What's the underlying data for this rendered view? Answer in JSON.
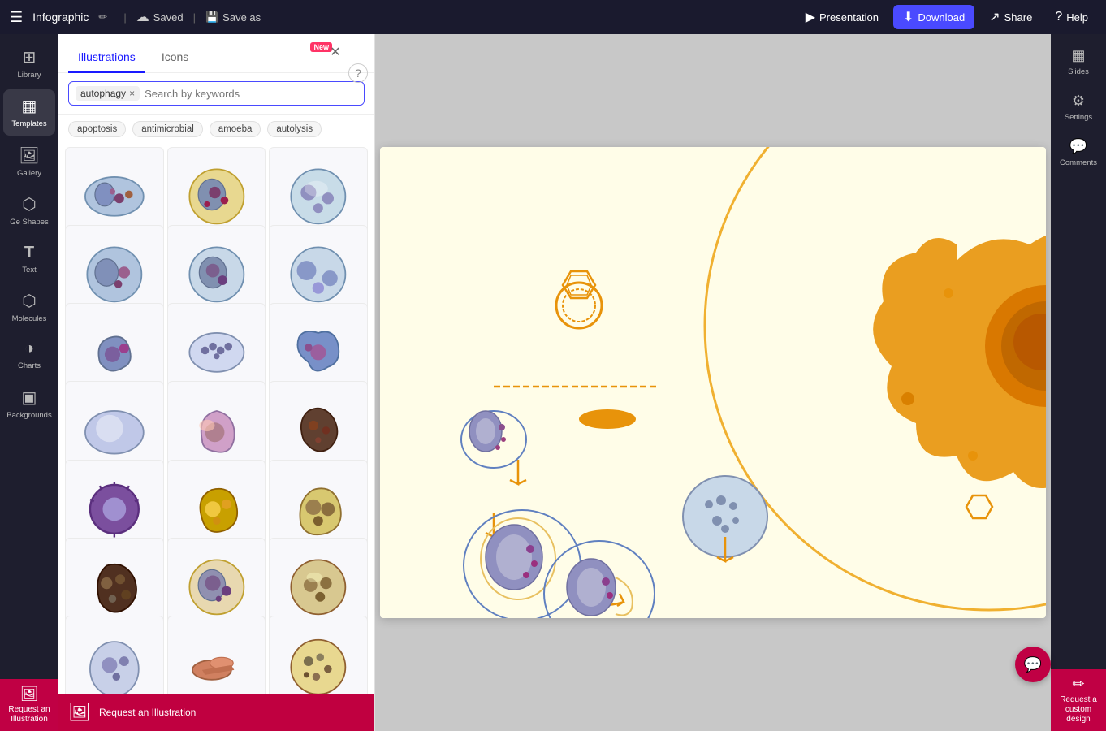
{
  "topbar": {
    "menu_icon": "☰",
    "title": "Infographic",
    "edit_icon": "✏",
    "saved_label": "Saved",
    "save_as_label": "Save as",
    "presentation_label": "Presentation",
    "download_label": "Download",
    "share_label": "Share",
    "help_label": "Help"
  },
  "left_sidebar": {
    "items": [
      {
        "id": "library",
        "icon": "⊞",
        "label": "Library"
      },
      {
        "id": "templates",
        "icon": "▦",
        "label": "Templates"
      },
      {
        "id": "gallery",
        "icon": "🖼",
        "label": "Gallery"
      },
      {
        "id": "shapes",
        "icon": "⬡",
        "label": "Ge Shapes"
      },
      {
        "id": "text",
        "icon": "T",
        "label": "Text"
      },
      {
        "id": "molecules",
        "icon": "⬡",
        "label": "Molecules"
      },
      {
        "id": "charts",
        "icon": "◑",
        "label": "Charts"
      },
      {
        "id": "backgrounds",
        "icon": "▣",
        "label": "Backgrounds"
      }
    ]
  },
  "panel": {
    "tab_illustrations": "Illustrations",
    "tab_icons": "Icons",
    "new_badge": "New",
    "close_icon": "✕",
    "help_icon": "?",
    "search": {
      "tag": "autophagy",
      "placeholder": "Search by keywords",
      "remove_icon": "×"
    },
    "keywords": [
      "apoptosis",
      "antimicrobial",
      "amoeba",
      "autolysis"
    ]
  },
  "right_sidebar": {
    "items": [
      {
        "id": "slides",
        "icon": "▦",
        "label": "Slides"
      },
      {
        "id": "settings",
        "icon": "⚙",
        "label": "Settings"
      },
      {
        "id": "comments",
        "icon": "💬",
        "label": "Comments"
      }
    ]
  },
  "cta": {
    "request_illustration": "Request an Illustration",
    "request_custom": "Request a custom design",
    "chat_icon": "💬"
  },
  "canvas": {
    "background_color": "#fffde8"
  }
}
